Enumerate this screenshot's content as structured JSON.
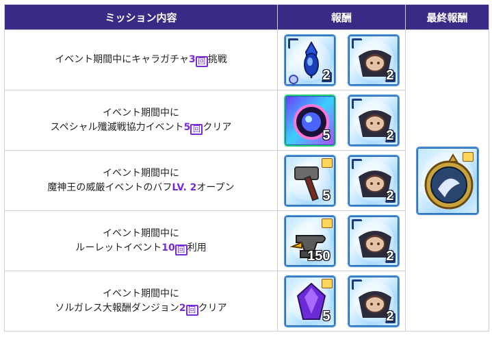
{
  "header": {
    "mission_col": "ミッション内容",
    "reward_col": "報酬",
    "final_col": "最終報酬"
  },
  "missions": [
    {
      "line1": "イベント期間中にキャラガチャ",
      "num": "3",
      "box": "回",
      "line1_tail": "挑戦",
      "line2": "",
      "rewards": [
        {
          "icon": "blue-pendant-icon",
          "qty": "2"
        },
        {
          "icon": "demon-character-ticket-icon",
          "qty": "2"
        }
      ]
    },
    {
      "line1": "イベント期間中に",
      "line2_head": "スペシャル殲滅戦協力イベント",
      "num": "5",
      "box": "回",
      "line2_tail": "クリア",
      "rewards": [
        {
          "icon": "rainbow-orb-icon",
          "qty": "5"
        },
        {
          "icon": "demon-character-ticket-icon",
          "qty": "2"
        }
      ]
    },
    {
      "line1": "イベント期間中に",
      "line2_head": "魔神王の威厳イベントのバフ",
      "lv": "LV. 2",
      "line2_tail": "オープン",
      "rewards": [
        {
          "icon": "hammer-icon",
          "qty": "5"
        },
        {
          "icon": "demon-character-ticket-icon",
          "qty": "2"
        }
      ]
    },
    {
      "line1": "イベント期間中に",
      "line2_head": "ルーレットイベント",
      "num": "10",
      "box": "回",
      "line2_tail": "利用",
      "rewards": [
        {
          "icon": "anvil-icon",
          "qty": "150"
        },
        {
          "icon": "demon-character-ticket-icon",
          "qty": "2"
        }
      ]
    },
    {
      "line1": "イベント期間中に",
      "line2_head": "ソルガレス大報酬ダンジョン",
      "num": "2",
      "box": "回",
      "line2_tail": "クリア",
      "rewards": [
        {
          "icon": "purple-gem-icon",
          "qty": "5"
        },
        {
          "icon": "demon-character-ticket-icon",
          "qty": "2"
        }
      ]
    }
  ],
  "final_reward": {
    "icon": "gold-medallion-icon"
  },
  "colors": {
    "header_bg": "#3a2a86",
    "highlight": "#7a2bd8"
  }
}
